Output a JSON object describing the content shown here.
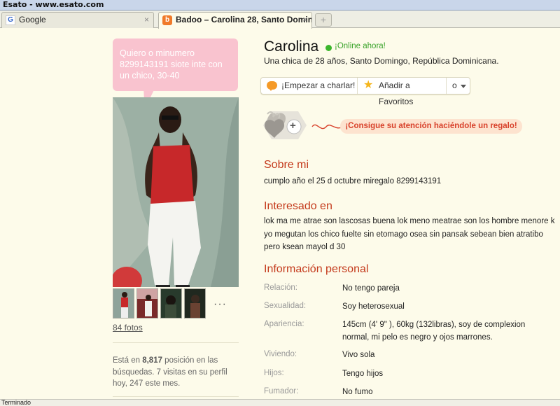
{
  "window": {
    "title": "Esato - www.esato.com"
  },
  "tabs": [
    {
      "label": "Google",
      "favicon": "google-favicon",
      "active": false
    },
    {
      "label": "Badoo – Carolina 28, Santo Domin...",
      "favicon": "badoo-favicon",
      "active": true
    }
  ],
  "tab_close_glyph": "×",
  "tab_new_glyph": "+",
  "left": {
    "bubble_text": "Quiero o minumero 8299143191 siote inte con un chico, 30-40",
    "photos_link": "84 fotos",
    "more_thumbs": "···",
    "rank_prefix": "Está en ",
    "rank_number": "8,817",
    "rank_suffix": " posición en las búsquedas. 7 visitas en su perfil hoy, 247 este mes."
  },
  "profile": {
    "name": "Carolina",
    "online_label": "¡Online ahora!",
    "subtitle": "Una chica de 28 años, Santo Domingo, República Dominicana."
  },
  "actions": {
    "chat_label": "¡Empezar a charlar!",
    "favorites_label": "Añadir a Favoritos",
    "more_label": "o"
  },
  "gift": {
    "plus_glyph": "+",
    "cta": "¡Consigue su atención haciéndole un regalo!"
  },
  "about": {
    "title": "Sobre mi",
    "text": "cumplo año el 25 d octubre miregalo 8299143191"
  },
  "interested": {
    "title": "Interesado en",
    "text": "lok ma me atrae son lascosas buena lok meno meatrae son los hombre menore k yo megutan los chico fuelte sin etomago osea sin pansak sebean bien atratibo pero ksean mayol d 30"
  },
  "personal": {
    "title": "Información personal",
    "rows": [
      {
        "label": "Relación:",
        "value": "No tengo pareja"
      },
      {
        "label": "Sexualidad:",
        "value": "Soy heterosexual"
      },
      {
        "label": "Apariencia:",
        "value": "145cm (4' 9\" ), 60kg (132libras), soy de complexion normal, mi pelo es negro y ojos marrones."
      },
      {
        "label": "Viviendo:",
        "value": "Vivo sola"
      },
      {
        "label": "Hijos:",
        "value": "Tengo hijos"
      },
      {
        "label": "Fumador:",
        "value": "No fumo"
      }
    ]
  },
  "status_bar": {
    "text": "Terminado"
  },
  "colors": {
    "page_bg": "#fdfbea",
    "accent_red": "#c43a1c",
    "online_green": "#3cb62c",
    "bubble_pink": "#f9c3cf",
    "cta_bg": "#fde3cf"
  }
}
